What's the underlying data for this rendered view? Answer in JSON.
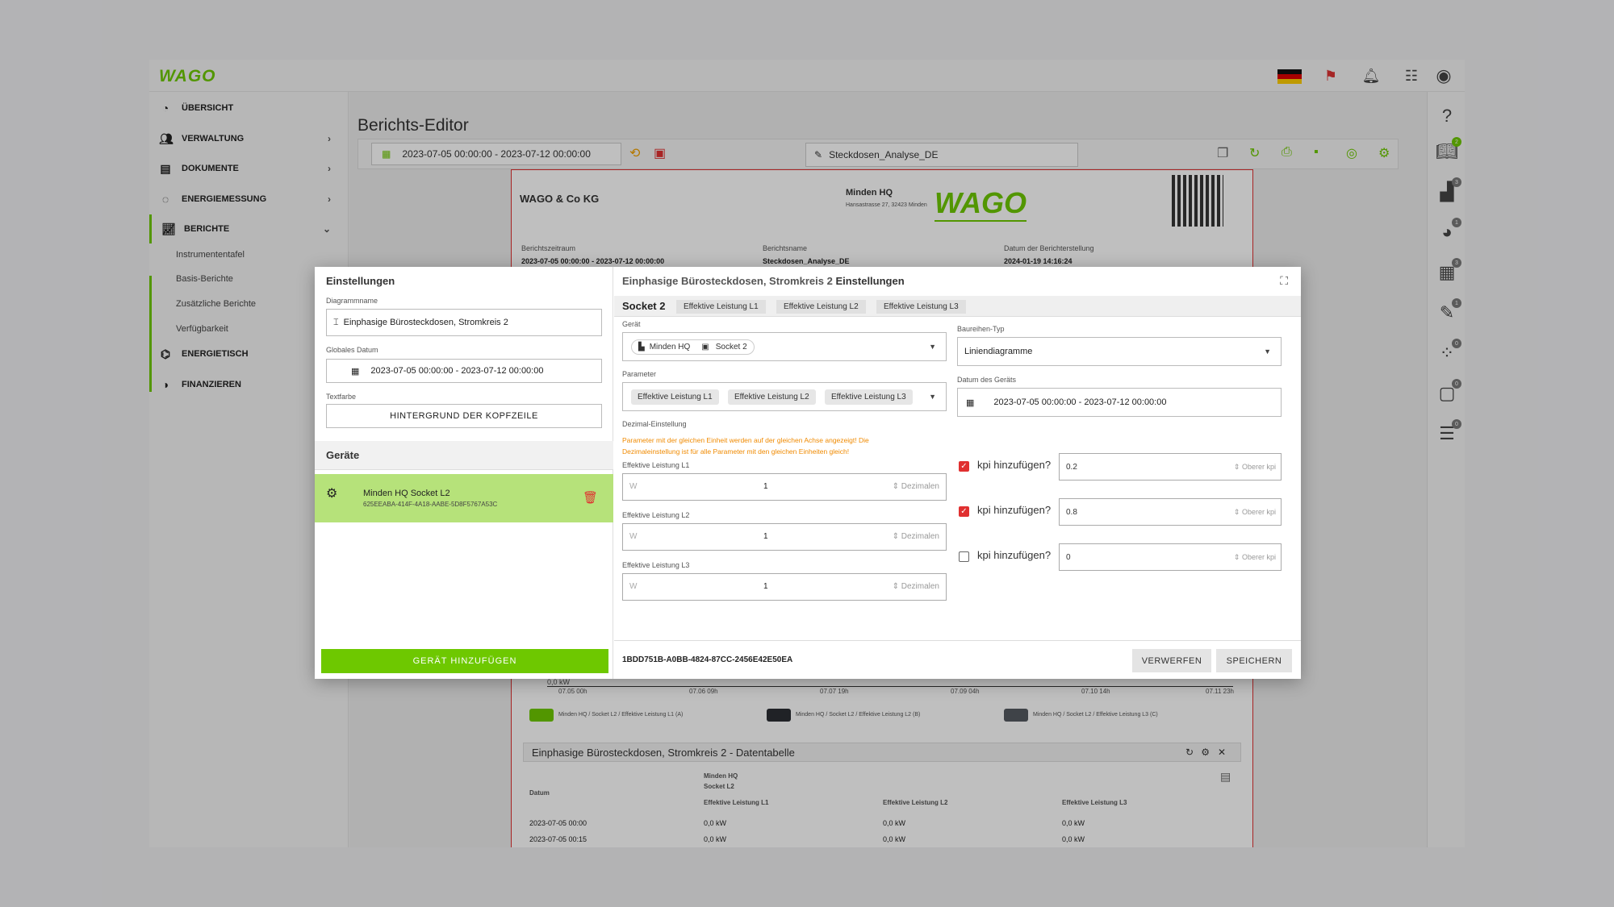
{
  "topbar": {
    "logo": "WAGO"
  },
  "sidebar": {
    "items": [
      {
        "label": "ÜBERSICHT"
      },
      {
        "label": "VERWALTUNG"
      },
      {
        "label": "DOKUMENTE"
      },
      {
        "label": "ENERGIEMESSUNG"
      },
      {
        "label": "BERICHTE"
      },
      {
        "label": "ENERGIETISCH"
      },
      {
        "label": "FINANZIEREN"
      }
    ],
    "subitems": [
      "Instrumententafel",
      "Basis-Berichte",
      "Zusätzliche Berichte",
      "Verfügbarkeit"
    ]
  },
  "rightbar": {
    "badges": [
      "2",
      "3",
      "1",
      "3",
      "1",
      "0",
      "0",
      "0"
    ]
  },
  "page": {
    "title": "Berichts-Editor",
    "date_range": "2023-07-05 00:00:00 - 2023-07-12 00:00:00",
    "report_name": "Steckdosen_Analyse_DE"
  },
  "report": {
    "company": "WAGO & Co KG",
    "location": "Minden HQ",
    "address": "Hansastrasse 27, 32423 Minden",
    "logo": "WAGO",
    "labels": [
      "Berichtszeitraum",
      "Berichtsname",
      "Datum der Berichterstellung"
    ],
    "values": [
      "2023-07-05 00:00:00 - 2023-07-12 00:00:00",
      "Steckdosen_Analyse_DE",
      "2024-01-19 14:16:24"
    ],
    "chart_ticks": [
      "07.05 00h",
      "07.06 09h",
      "07.07 19h",
      "07.09 04h",
      "07.10 14h",
      "07.11 23h"
    ],
    "chart_zero": "0,0 kW",
    "legend": [
      "Minden HQ / Socket L2 / Effektive Leistung L1 (A)",
      "Minden HQ / Socket L2 / Effektive Leistung L2 (B)",
      "Minden HQ / Socket L2 / Effektive Leistung L3 (C)"
    ],
    "table_title": "Einphasige Bürosteckdosen, Stromkreis 2 - Datentabelle",
    "table_head": {
      "datum": "Datum",
      "device": "Minden HQ",
      "socket": "Socket L2",
      "c1": "Effektive Leistung L1",
      "c2": "Effektive Leistung L2",
      "c3": "Effektive Leistung L3"
    },
    "table_rows": [
      {
        "d": "2023-07-05 00:00",
        "a": "0,0 kW",
        "b": "0,0 kW",
        "c": "0,0 kW"
      },
      {
        "d": "2023-07-05 00:15",
        "a": "0,0 kW",
        "b": "0,0 kW",
        "c": "0,0 kW"
      }
    ]
  },
  "dialog": {
    "left_title": "Einstellungen",
    "diagram_name_label": "Diagrammname",
    "diagram_name": "Einphasige Bürosteckdosen, Stromkreis 2",
    "global_date_label": "Globales Datum",
    "global_date": "2023-07-05 00:00:00 - 2023-07-12 00:00:00",
    "text_color_label": "Textfarbe",
    "header_bg_button": "HINTERGRUND DER KOPFZEILE",
    "devices_title": "Geräte",
    "device_name": "Minden HQ Socket L2",
    "device_id": "625EEABA-414F-4A18-AABE-5D8F5767A53C",
    "add_device": "GERÄT HINZUFÜGEN",
    "right_title": "Einphasige Bürosteckdosen, Stromkreis 2",
    "right_title_suffix": "Einstellungen",
    "tabs": [
      "Socket 2",
      "Effektive Leistung L1",
      "Effektive Leistung L2",
      "Effektive Leistung L3"
    ],
    "device_label": "Gerät",
    "device_chip1": "Minden HQ",
    "device_chip2": "Socket 2",
    "param_label": "Parameter",
    "params": [
      "Effektive Leistung L1",
      "Effektive Leistung L2",
      "Effektive Leistung L3"
    ],
    "decimal_label": "Dezimal-Einstellung",
    "decimal_note": "Parameter mit der gleichen Einheit werden auf der gleichen Achse angezeigt! Die Dezimaleinstellung ist für alle Parameter mit den gleichen Einheiten gleich!",
    "fields": [
      {
        "label": "Effektive Leistung L1",
        "unit": "W",
        "value": "1",
        "placeholder": "Dezimalen"
      },
      {
        "label": "Effektive Leistung L2",
        "unit": "W",
        "value": "1",
        "placeholder": "Dezimalen"
      },
      {
        "label": "Effektive Leistung L3",
        "unit": "W",
        "value": "1",
        "placeholder": "Dezimalen"
      }
    ],
    "series_type_label": "Baureihen-Typ",
    "series_type": "Liniendiagramme",
    "device_date_label": "Datum des Geräts",
    "device_date": "2023-07-05 00:00:00 - 2023-07-12 00:00:00",
    "kpis": [
      {
        "label": "kpi hinzufügen?",
        "checked": true,
        "value": "0.2",
        "placeholder": "Oberer kpi"
      },
      {
        "label": "kpi hinzufügen?",
        "checked": true,
        "value": "0.8",
        "placeholder": "Oberer kpi"
      },
      {
        "label": "kpi hinzufügen?",
        "checked": false,
        "value": "0",
        "placeholder": "Oberer kpi"
      }
    ],
    "footer_id": "1BDD751B-A0BB-4824-87CC-2456E42E50EA",
    "discard": "VERWERFEN",
    "save": "SPEICHERN"
  }
}
